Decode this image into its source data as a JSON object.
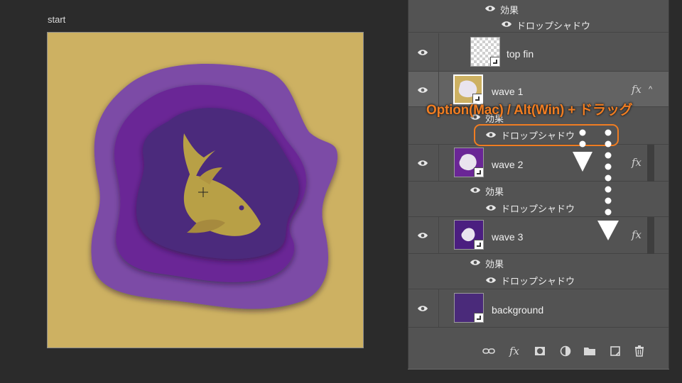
{
  "document": {
    "title": "start"
  },
  "layers_panel": {
    "top_effects": {
      "group_label": "効果",
      "effect_label": "ドロップシャドウ"
    },
    "layers": [
      {
        "name": "top fin",
        "has_fx": false
      },
      {
        "name": "wave 1",
        "has_fx": true,
        "fx_label": "fx",
        "caret": "^",
        "effects_label": "効果",
        "effect_label": "ドロップシャドウ",
        "selected": true
      },
      {
        "name": "wave 2",
        "has_fx": true,
        "fx_label": "fx",
        "caret": "^",
        "effects_label": "効果",
        "effect_label": "ドロップシャドウ"
      },
      {
        "name": "wave 3",
        "has_fx": true,
        "fx_label": "fx",
        "caret": "^",
        "effects_label": "効果",
        "effect_label": "ドロップシャドウ"
      },
      {
        "name": "background",
        "has_fx": false
      }
    ],
    "toolbar": [
      "link-icon",
      "fx-icon",
      "mask-icon",
      "adjustment-icon",
      "folder-icon",
      "new-layer-icon",
      "trash-icon"
    ]
  },
  "annotation": {
    "instruction": "Option(Mac) / Alt(Win) + ドラッグ",
    "accent_color": "#f07d22"
  },
  "colors": {
    "artboard_bg": "#cdb162",
    "purple_light": "#7b4ba6",
    "purple_mid": "#5e2a8e",
    "purple_dark": "#4a2a7a",
    "fish": "#b8a046"
  }
}
